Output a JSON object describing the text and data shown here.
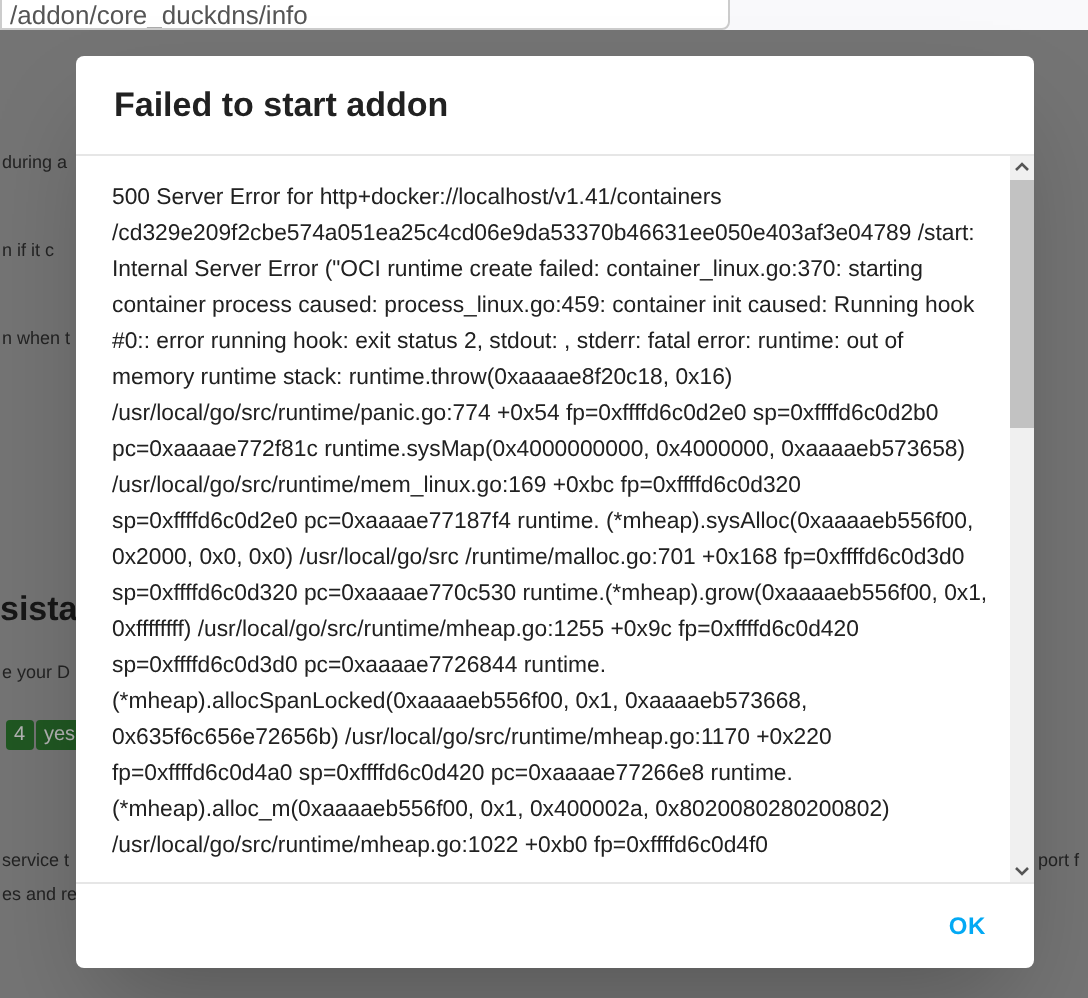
{
  "browser": {
    "url": "/addon/core_duckdns/info"
  },
  "background": {
    "fragments": [
      {
        "kind": "text",
        "text": "during a"
      },
      {
        "kind": "text",
        "text": "n if it c"
      },
      {
        "kind": "text",
        "text": "n when t"
      },
      {
        "kind": "heading",
        "text": "sista"
      },
      {
        "kind": "text",
        "text": "e your D"
      },
      {
        "kind": "badge",
        "text": "4"
      },
      {
        "kind": "badge",
        "text": "yes"
      },
      {
        "kind": "text",
        "text": "service t"
      },
      {
        "kind": "text",
        "text": "es and re"
      },
      {
        "kind": "right",
        "text": "port f"
      }
    ]
  },
  "dialog": {
    "title": "Failed to start addon",
    "message": "500 Server Error for http+docker://localhost/v1.41/containers /cd329e209f2cbe574a051ea25c4cd06e9da53370b46631ee050e403af3e04789 /start: Internal Server Error (\"OCI runtime create failed: container_linux.go:370: starting container process caused: process_linux.go:459: container init caused: Running hook #0:: error running hook: exit status 2, stdout: , stderr: fatal error: runtime: out of memory runtime stack: runtime.throw(0xaaaae8f20c18, 0x16) /usr/local/go/src/runtime/panic.go:774 +0x54 fp=0xffffd6c0d2e0 sp=0xffffd6c0d2b0 pc=0xaaaae772f81c runtime.sysMap(0x4000000000, 0x4000000, 0xaaaaeb573658) /usr/local/go/src/runtime/mem_linux.go:169 +0xbc fp=0xffffd6c0d320 sp=0xffffd6c0d2e0 pc=0xaaaae77187f4 runtime. (*mheap).sysAlloc(0xaaaaeb556f00, 0x2000, 0x0, 0x0) /usr/local/go/src /runtime/malloc.go:701 +0x168 fp=0xffffd6c0d3d0 sp=0xffffd6c0d320 pc=0xaaaae770c530 runtime.(*mheap).grow(0xaaaaeb556f00, 0x1, 0xffffffff) /usr/local/go/src/runtime/mheap.go:1255 +0x9c fp=0xffffd6c0d420 sp=0xffffd6c0d3d0 pc=0xaaaae7726844 runtime. (*mheap).allocSpanLocked(0xaaaaeb556f00, 0x1, 0xaaaaeb573668, 0x635f6c656e72656b) /usr/local/go/src/runtime/mheap.go:1170 +0x220 fp=0xffffd6c0d4a0 sp=0xffffd6c0d420 pc=0xaaaae77266e8 runtime. (*mheap).alloc_m(0xaaaaeb556f00, 0x1, 0x400002a, 0x8020080280200802) /usr/local/go/src/runtime/mheap.go:1022 +0xb0 fp=0xffffd6c0d4f0",
    "button": "OK"
  }
}
